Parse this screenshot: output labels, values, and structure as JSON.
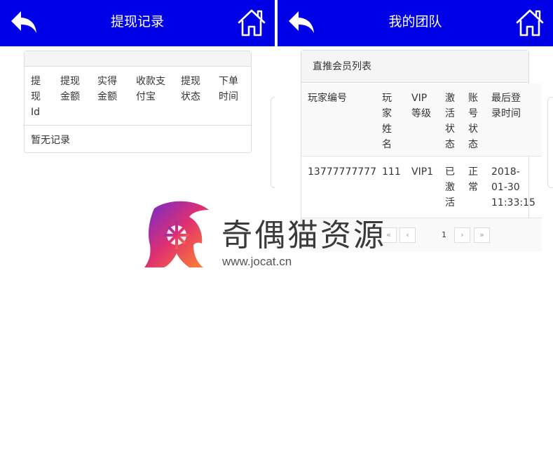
{
  "left_screen": {
    "title": "提现记录",
    "back_icon": "back-arrow-icon",
    "home_icon": "home-icon",
    "table": {
      "headers": [
        {
          "lines": [
            "提",
            "现",
            "Id"
          ]
        },
        {
          "lines": [
            "提现",
            "金额"
          ]
        },
        {
          "lines": [
            "实得",
            "金额"
          ]
        },
        {
          "lines": [
            "收款支",
            "付宝"
          ]
        },
        {
          "lines": [
            "提现",
            "状态"
          ]
        },
        {
          "lines": [
            "下单",
            "时间"
          ]
        }
      ],
      "empty_text": "暂无记录"
    }
  },
  "right_screen": {
    "title": "我的团队",
    "back_icon": "back-arrow-icon",
    "home_icon": "home-icon",
    "panel_title": "直推会员列表",
    "table": {
      "headers": [
        {
          "lines": [
            "玩家编号"
          ]
        },
        {
          "lines": [
            "玩",
            "家",
            "姓",
            "名"
          ]
        },
        {
          "lines": [
            "VIP",
            "等级"
          ]
        },
        {
          "lines": [
            "激",
            "活",
            "状",
            "态"
          ]
        },
        {
          "lines": [
            "账",
            "号",
            "状",
            "态"
          ]
        },
        {
          "lines": [
            "最后登",
            "录时间"
          ]
        }
      ],
      "rows": [
        [
          {
            "lines": [
              "13777777777"
            ]
          },
          {
            "lines": [
              "111"
            ]
          },
          {
            "lines": [
              "VIP1"
            ]
          },
          {
            "lines": [
              "已",
              "激",
              "活"
            ]
          },
          {
            "lines": [
              "正",
              "常"
            ]
          },
          {
            "lines": [
              "2018-",
              "01-30",
              "11:33:15"
            ]
          }
        ]
      ]
    },
    "pagination": {
      "first": "«",
      "prev": "‹",
      "current": "1",
      "next": "›",
      "last": "»"
    }
  },
  "watermark": {
    "text": "奇偶猫资源",
    "url": "www.jocat.cn"
  },
  "colors": {
    "header_bg": "#0000e6",
    "header_text": "#ffffff",
    "border": "#dddddd"
  }
}
